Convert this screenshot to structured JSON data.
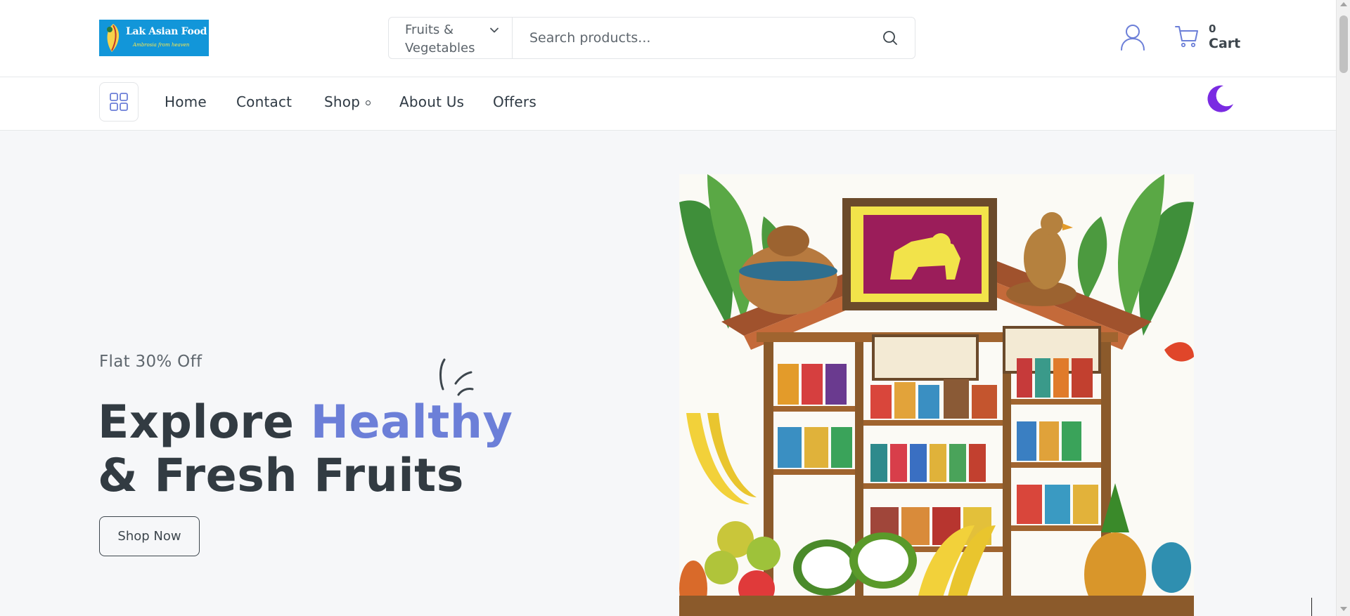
{
  "header": {
    "logo": {
      "name": "Lak Asian Food",
      "tagline": "Ambrosia from heaven"
    },
    "search": {
      "category": "Fruits & Vegetables",
      "placeholder": "Search products..."
    },
    "cart": {
      "count": "0",
      "label": "Cart"
    },
    "icons": {
      "user": "user-icon",
      "cart": "cart-icon",
      "search": "search-icon",
      "chevron": "chevron-down-icon"
    }
  },
  "nav": {
    "items": [
      {
        "label": "Home"
      },
      {
        "label": "Contact"
      },
      {
        "label": "Shop"
      },
      {
        "label": "About Us"
      },
      {
        "label": "Offers"
      }
    ],
    "icons": {
      "menu": "grid-menu-icon",
      "theme": "moon-icon"
    }
  },
  "hero": {
    "subtitle": "Flat 30% Off",
    "title_part1": "Explore ",
    "title_accent": "Healthy",
    "title_line2": "& Fresh Fruits",
    "cta": "Shop Now"
  },
  "colors": {
    "accent": "#6c7fd8",
    "heading": "#323b42",
    "hero_bg": "#f6f7f9",
    "logo_bg": "#1296d9",
    "moon": "#7a2be2"
  }
}
